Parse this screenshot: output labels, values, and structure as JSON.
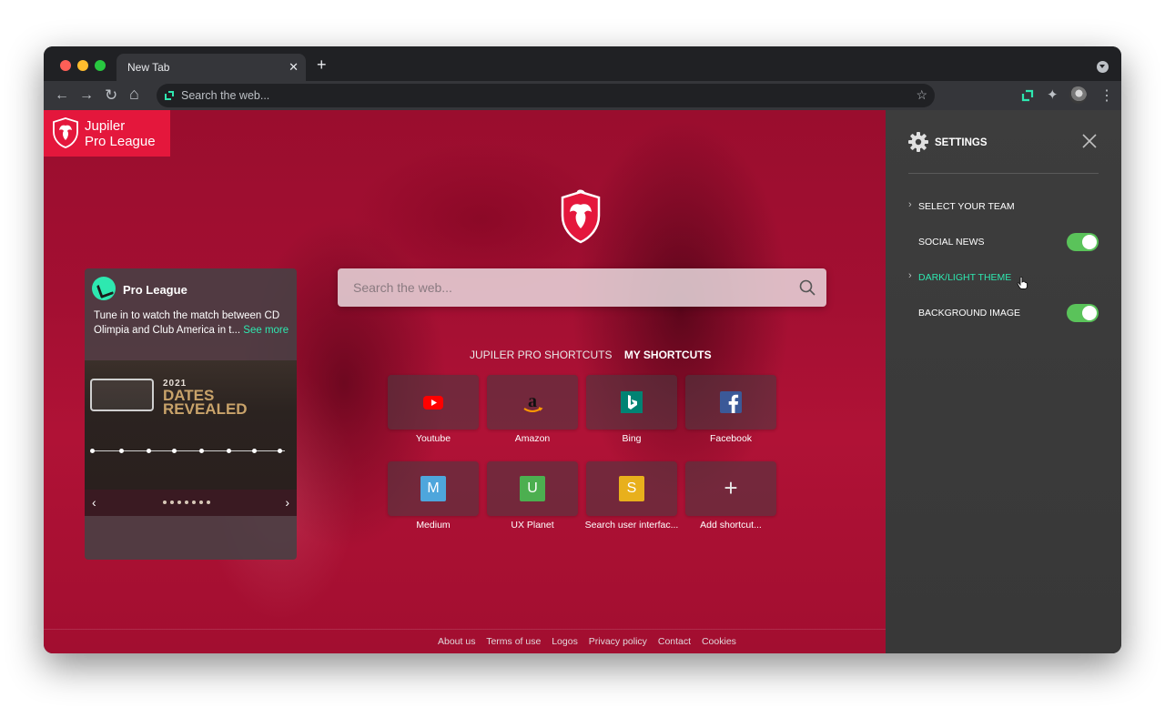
{
  "browser": {
    "tab_title": "New Tab",
    "omnibox_placeholder": "Search the web...",
    "close_glyph": "✕",
    "new_tab_glyph": "+",
    "back_glyph": "←",
    "forward_glyph": "→",
    "reload_glyph": "↻",
    "home_glyph": "⌂",
    "star_glyph": "☆",
    "puzzle_glyph": "✦",
    "menu_glyph": "⋮"
  },
  "brand": {
    "line1": "Jupiler",
    "line2": "Pro League",
    "color": "#e4173c"
  },
  "news": {
    "title": "Pro League",
    "text": "Tune in to watch the match between CD Olimpia and Club America in t...",
    "see_more": "See more",
    "image": {
      "year": "2021",
      "headline_1": "DATES",
      "headline_2": "REVEALED"
    },
    "prev_glyph": "‹",
    "next_glyph": "›"
  },
  "search": {
    "placeholder": "Search the web..."
  },
  "shortcut_tabs": {
    "tab1": "JUPILER PRO SHORTCUTS",
    "tab2": "MY SHORTCUTS"
  },
  "shortcuts": [
    {
      "label": "Youtube",
      "icon": "youtube-icon"
    },
    {
      "label": "Amazon",
      "icon": "amazon-icon"
    },
    {
      "label": "Bing",
      "icon": "bing-icon"
    },
    {
      "label": "Facebook",
      "icon": "facebook-icon"
    },
    {
      "label": "Medium",
      "icon": "medium-icon",
      "letter": "M",
      "color": "#4ea6dc"
    },
    {
      "label": "UX Planet",
      "icon": "ux-planet-icon",
      "letter": "U",
      "color": "#4caf50"
    },
    {
      "label": "Search user interfac...",
      "icon": "search-ui-icon",
      "letter": "S",
      "color": "#e8b01c"
    },
    {
      "label": "Add shortcut...",
      "icon": "plus-icon",
      "glyph": "+"
    }
  ],
  "footer": [
    "About us",
    "Terms of use",
    "Logos",
    "Privacy policy",
    "Contact",
    "Cookies"
  ],
  "settings": {
    "title": "SETTINGS",
    "items": [
      {
        "label": "SELECT YOUR TEAM",
        "type": "expand"
      },
      {
        "label": "SOCIAL NEWS",
        "type": "toggle",
        "on": true
      },
      {
        "label": "DARK/LIGHT THEME",
        "type": "expand",
        "hover": true
      },
      {
        "label": "BACKGROUND IMAGE",
        "type": "toggle",
        "on": true
      }
    ],
    "chevron": "›",
    "accent": "#2ee8b0",
    "toggle_color": "#5ac35a"
  }
}
